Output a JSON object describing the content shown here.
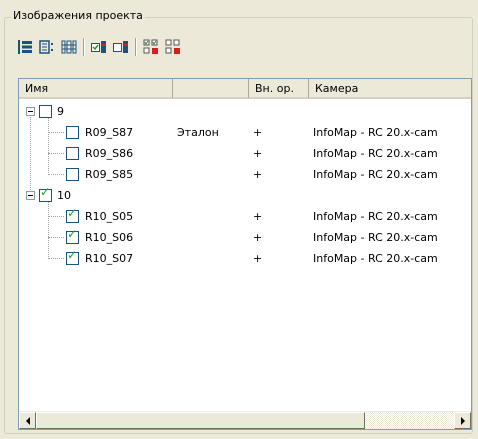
{
  "group_title": "Изображения проекта",
  "toolbar": {
    "buttons": [
      {
        "name": "expand-all",
        "icon": "tree-expand-icon"
      },
      {
        "name": "collapse-all",
        "icon": "tree-collapse-icon"
      },
      {
        "name": "list-view",
        "icon": "list-view-icon"
      },
      {
        "name": "check-selected",
        "icon": "check-image-icon"
      },
      {
        "name": "uncheck-selected",
        "icon": "uncheck-image-icon"
      },
      {
        "name": "select-all",
        "icon": "grid-select-icon"
      },
      {
        "name": "deselect-all",
        "icon": "grid-deselect-icon"
      }
    ]
  },
  "columns": [
    "Имя",
    "",
    "Вн. ор.",
    "Камера"
  ],
  "rows": [
    {
      "level": 0,
      "expanded": true,
      "checked": false,
      "name": "9",
      "ref": "",
      "io": "",
      "camera": ""
    },
    {
      "level": 1,
      "checked": false,
      "name": "R09_S87",
      "ref": "Эталон",
      "io": "+",
      "camera": "InfoMap - RC 20.x-cam"
    },
    {
      "level": 1,
      "checked": false,
      "name": "R09_S86",
      "ref": "",
      "io": "+",
      "camera": "InfoMap - RC 20.x-cam"
    },
    {
      "level": 1,
      "checked": false,
      "name": "R09_S85",
      "ref": "",
      "io": "+",
      "camera": "InfoMap - RC 20.x-cam"
    },
    {
      "level": 0,
      "expanded": true,
      "checked": true,
      "name": "10",
      "ref": "",
      "io": "",
      "camera": ""
    },
    {
      "level": 1,
      "checked": true,
      "name": "R10_S05",
      "ref": "",
      "io": "+",
      "camera": "InfoMap - RC 20.x-cam"
    },
    {
      "level": 1,
      "checked": true,
      "name": "R10_S06",
      "ref": "",
      "io": "+",
      "camera": "InfoMap - RC 20.x-cam"
    },
    {
      "level": 1,
      "checked": true,
      "name": "R10_S07",
      "ref": "",
      "io": "+",
      "camera": "InfoMap - RC 20.x-cam"
    }
  ],
  "colors": {
    "accent_blue": "#1c5180",
    "check_green": "#21a121",
    "toolbar_red": "#d62020"
  }
}
